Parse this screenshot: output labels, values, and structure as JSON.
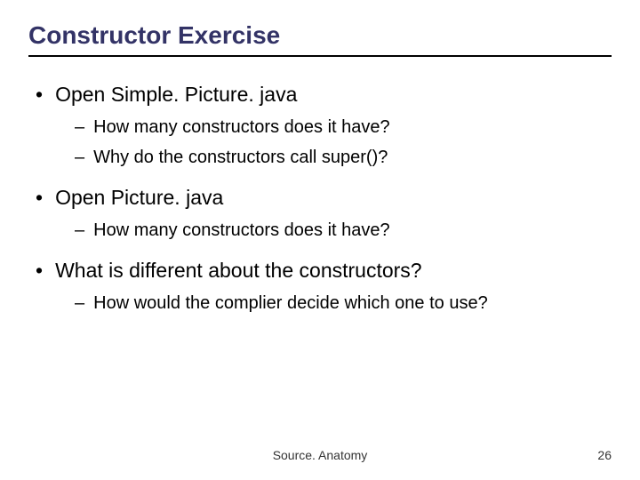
{
  "title": "Constructor Exercise",
  "bullets": [
    {
      "level": 1,
      "marker": "•",
      "text": "Open Simple. Picture. java"
    },
    {
      "level": 2,
      "marker": "–",
      "text": "How many constructors does it have?"
    },
    {
      "level": 2,
      "marker": "–",
      "text": "Why do the constructors call super()?"
    },
    {
      "level": 1,
      "marker": "•",
      "text": "Open Picture. java"
    },
    {
      "level": 2,
      "marker": "–",
      "text": "How many constructors does it have?"
    },
    {
      "level": 1,
      "marker": "•",
      "text": "What is different about the constructors?"
    },
    {
      "level": 2,
      "marker": "–",
      "text": "How would the complier decide which one to use?"
    }
  ],
  "footer": {
    "center": "Source. Anatomy",
    "page": "26"
  }
}
